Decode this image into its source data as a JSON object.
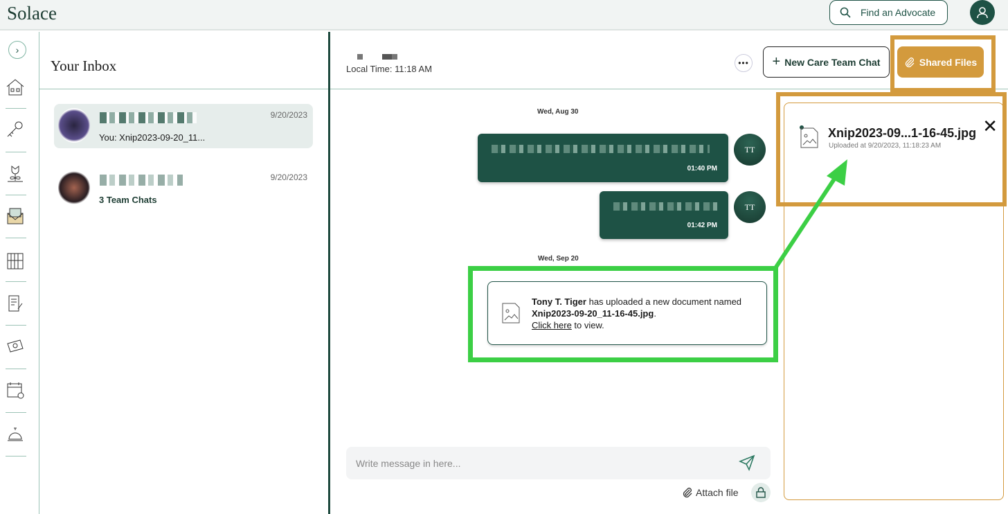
{
  "app": {
    "logo": "Solace"
  },
  "topbar": {
    "find_advocate": "Find an Advocate",
    "icons": {
      "search": "search-icon",
      "profile": "user-icon"
    }
  },
  "sidebar": {
    "icons": [
      "chevron-right-icon",
      "house-icon",
      "key-icon",
      "flower-icon",
      "mail-icon",
      "library-icon",
      "document-icon",
      "money-icon",
      "calendar-icon",
      "bell-icon"
    ]
  },
  "inbox": {
    "title": "Your Inbox",
    "conversations": [
      {
        "preview": "You: Xnip2023-09-20_11...",
        "date": "9/20/2023",
        "selected": true
      },
      {
        "preview": "3 Team Chats",
        "date": "9/20/2023",
        "selected": false
      }
    ]
  },
  "chat": {
    "local_time": "Local Time: 11:18 AM",
    "new_chat_label": "New Care Team Chat",
    "shared_files_label": "Shared Files",
    "days": [
      "Wed, Aug 30",
      "Wed, Sep 20"
    ],
    "messages": [
      {
        "time": "01:40 PM",
        "initials": "TT"
      },
      {
        "time": "01:42 PM",
        "initials": "TT"
      }
    ],
    "upload_notice": {
      "user": "Tony T. Tiger",
      "text": " has uploaded a new document named ",
      "file": "Xnip2023-09-20_11-16-45.jpg",
      "period": ".",
      "link": "Click here",
      "after": " to view."
    },
    "input_placeholder": "Write message in here...",
    "attach_label": "Attach file"
  },
  "shared_files": {
    "files": [
      {
        "name": "Xnip2023-09...1-16-45.jpg",
        "uploaded": "Uploaded at 9/20/2023, 11:18:23 AM"
      }
    ]
  },
  "colors": {
    "brand": "#1e5245",
    "accent": "#d39a3d",
    "annotation_green": "#3ccf45",
    "annotation_orange": "#d39a3d"
  }
}
